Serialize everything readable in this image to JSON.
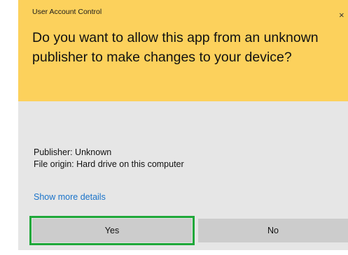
{
  "dialog": {
    "window_title": "User Account Control",
    "close_glyph": "×",
    "question": "Do you want to allow this app from an unknown publisher to make changes to your device?",
    "publisher": "Publisher: Unknown",
    "file_origin": "File origin: Hard drive on this computer",
    "show_more": "Show more details",
    "yes_label": "Yes",
    "no_label": "No"
  },
  "colors": {
    "banner": "#fcd15c",
    "body": "#e6e6e6",
    "button": "#cccccc",
    "link": "#1a73c9",
    "highlight": "#1fa83a"
  }
}
